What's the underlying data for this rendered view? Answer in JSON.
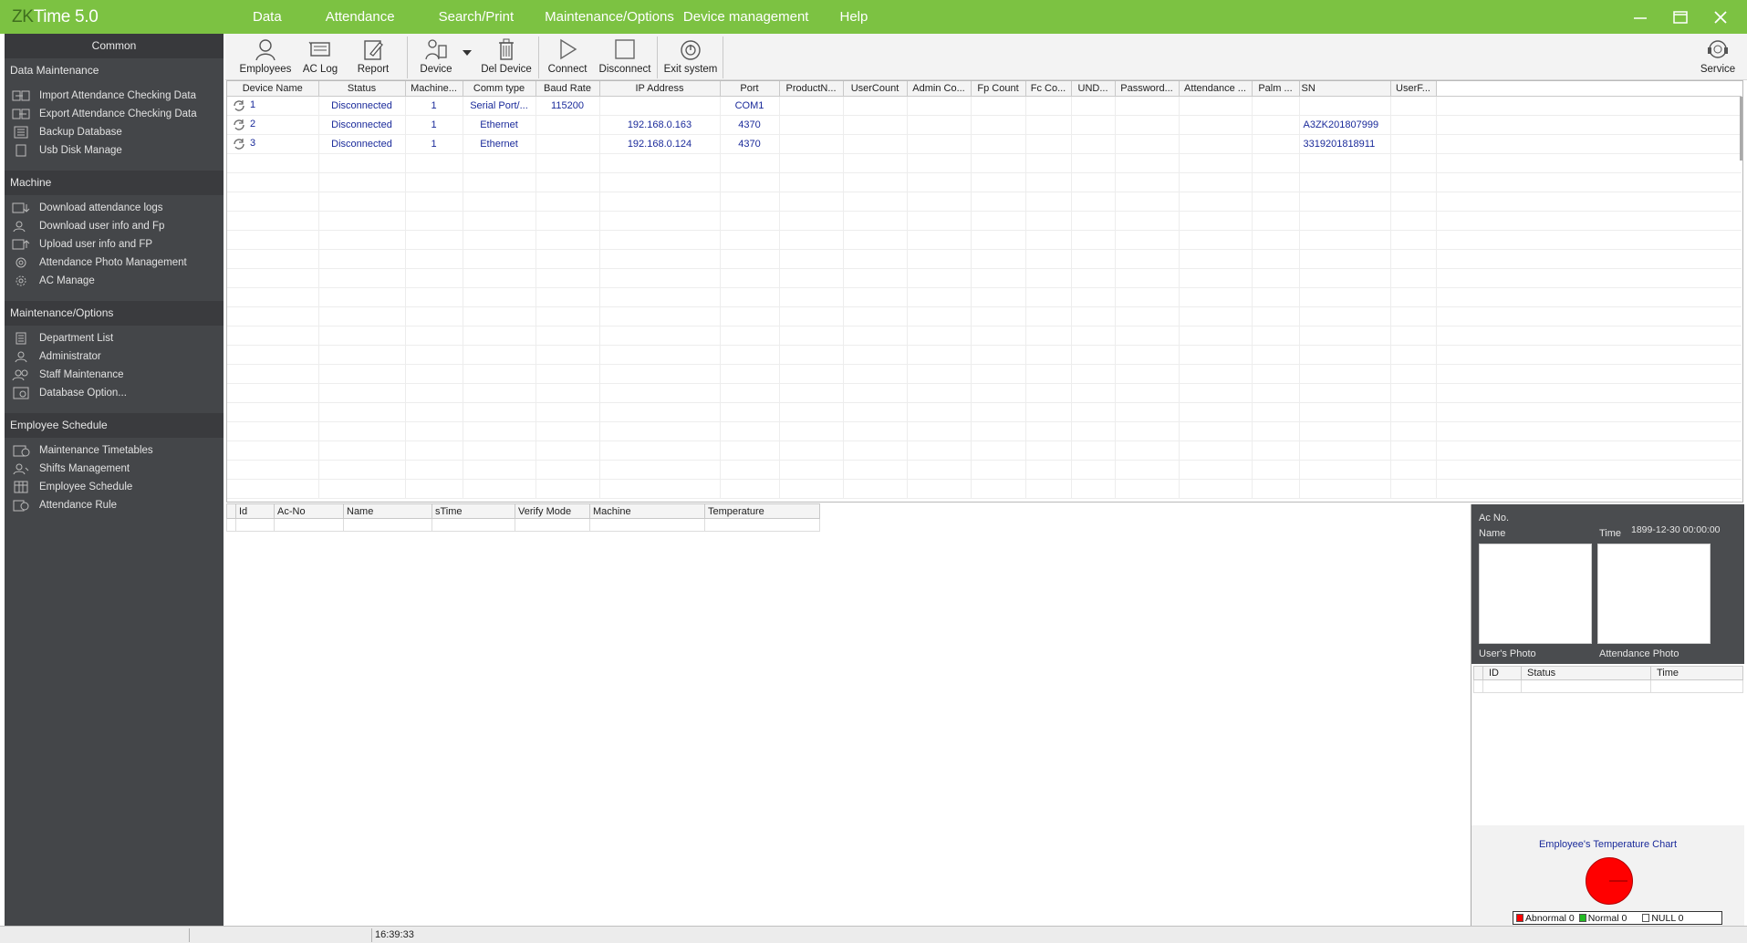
{
  "app": {
    "title_prefix": "ZK",
    "title_suffix": "Time 5.0"
  },
  "menu": [
    "Data",
    "Attendance",
    "Search/Print",
    "Maintenance/Options",
    "Device management",
    "Help"
  ],
  "sidebar": {
    "header": "Common",
    "sections": [
      {
        "title": "Data Maintenance",
        "items": [
          {
            "label": "Import Attendance Checking Data",
            "icon": "import-icon"
          },
          {
            "label": "Export Attendance Checking Data",
            "icon": "export-icon"
          },
          {
            "label": "Backup Database",
            "icon": "backup-icon"
          },
          {
            "label": "Usb Disk Manage",
            "icon": "usb-icon"
          }
        ]
      },
      {
        "title": "Machine",
        "items": [
          {
            "label": "Download attendance logs",
            "icon": "download-logs-icon"
          },
          {
            "label": "Download user info and Fp",
            "icon": "download-user-icon"
          },
          {
            "label": "Upload user info and FP",
            "icon": "upload-user-icon"
          },
          {
            "label": "Attendance Photo Management",
            "icon": "photo-icon"
          },
          {
            "label": "AC Manage",
            "icon": "gear-icon"
          }
        ]
      },
      {
        "title": "Maintenance/Options",
        "items": [
          {
            "label": "Department List",
            "icon": "department-icon"
          },
          {
            "label": "Administrator",
            "icon": "admin-icon"
          },
          {
            "label": "Staff Maintenance",
            "icon": "staff-icon"
          },
          {
            "label": "Database Option...",
            "icon": "database-icon"
          }
        ]
      },
      {
        "title": "Employee Schedule",
        "items": [
          {
            "label": "Maintenance Timetables",
            "icon": "timetable-icon"
          },
          {
            "label": "Shifts Management",
            "icon": "shifts-icon"
          },
          {
            "label": "Employee Schedule",
            "icon": "schedule-icon"
          },
          {
            "label": "Attendance Rule",
            "icon": "rule-icon"
          }
        ]
      }
    ]
  },
  "toolbar": {
    "employees": "Employees",
    "ac_log": "AC Log",
    "report": "Report",
    "device": "Device",
    "del_device": "Del Device",
    "connect": "Connect",
    "disconnect": "Disconnect",
    "exit_system": "Exit system",
    "service": "Service"
  },
  "device_table": {
    "columns": [
      "Device Name",
      "Status",
      "Machine...",
      "Comm type",
      "Baud Rate",
      "IP Address",
      "Port",
      "ProductN...",
      "UserCount",
      "Admin Co...",
      "Fp Count",
      "Fc Co...",
      "UND...",
      "Password...",
      "Attendance ...",
      "Palm ...",
      "SN",
      "UserF..."
    ],
    "rows": [
      {
        "name": "1",
        "status": "Disconnected",
        "machine": "1",
        "comm": "Serial Port/...",
        "baud": "115200",
        "ip": "",
        "port": "COM1",
        "sn": ""
      },
      {
        "name": "2",
        "status": "Disconnected",
        "machine": "1",
        "comm": "Ethernet",
        "baud": "",
        "ip": "192.168.0.163",
        "port": "4370",
        "sn": "A3ZK201807999"
      },
      {
        "name": "3",
        "status": "Disconnected",
        "machine": "1",
        "comm": "Ethernet",
        "baud": "",
        "ip": "192.168.0.124",
        "port": "4370",
        "sn": "3319201818911"
      }
    ]
  },
  "log_table": {
    "columns": [
      "Id",
      "Ac-No",
      "Name",
      "sTime",
      "Verify Mode",
      "Machine",
      "Temperature"
    ]
  },
  "photo_panel": {
    "ac_no_label": "Ac No.",
    "name_label": "Name",
    "time_label": "Time",
    "time_value": "1899-12-30 00:00:00",
    "user_photo": "User's Photo",
    "attendance_photo": "Attendance Photo"
  },
  "record_table": {
    "columns": [
      "ID",
      "Status",
      "Time"
    ]
  },
  "temperature": {
    "title": "Employee's Temperature Chart",
    "abnormal": "Abnormal 0",
    "normal": "Normal 0",
    "null": "NULL 0",
    "colors": {
      "abnormal": "#ff0000",
      "normal": "#22bb22",
      "null": "#ffffff"
    }
  },
  "status_bar": {
    "time": "16:39:33"
  }
}
